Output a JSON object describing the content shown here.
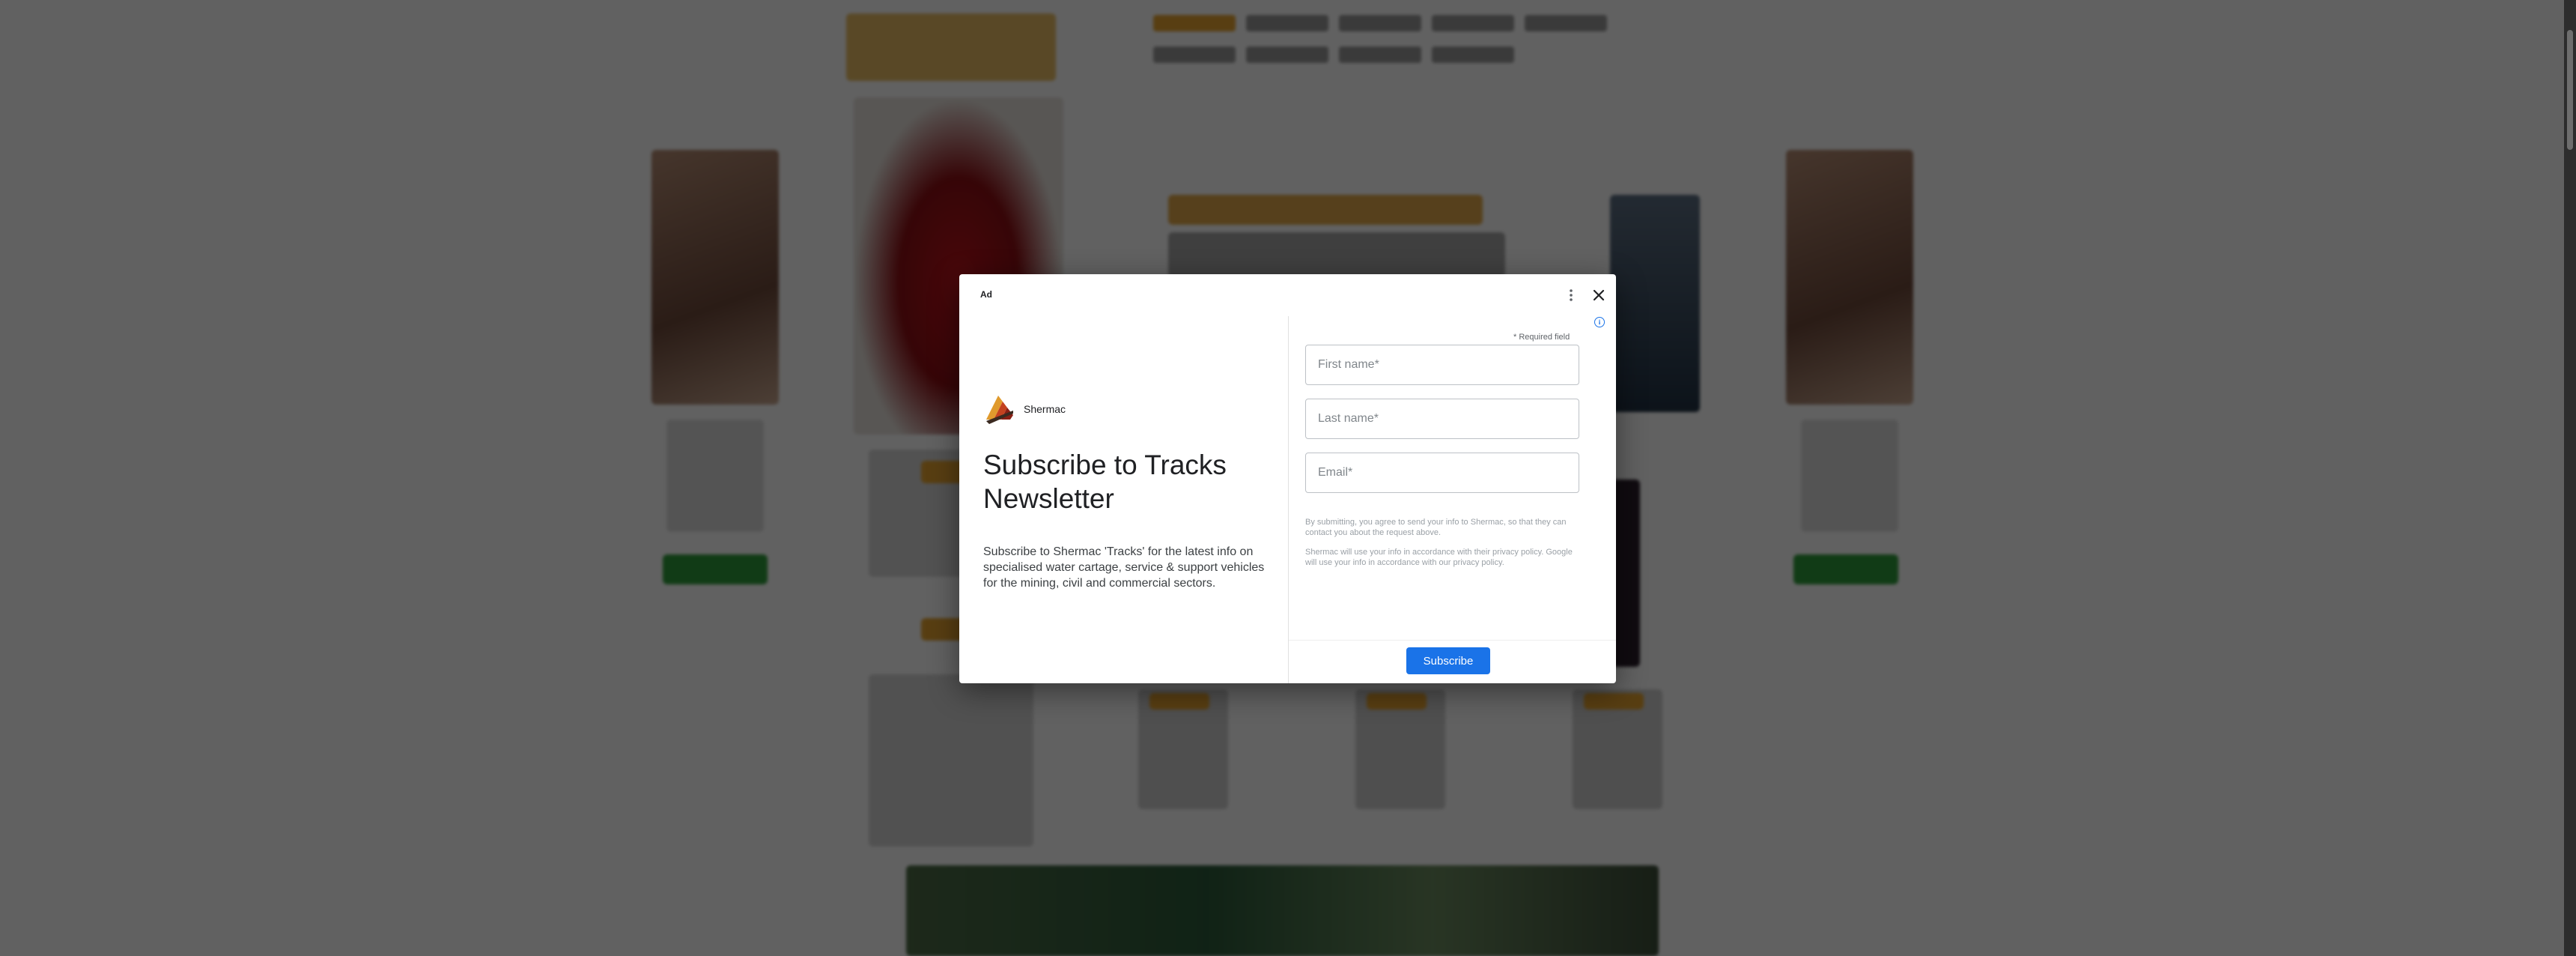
{
  "modal": {
    "ad_label": "Ad",
    "brand": {
      "name": "Shermac"
    },
    "headline": "Subscribe to Tracks Newsletter",
    "description": "Subscribe to Shermac 'Tracks' for the latest info on specialised water cartage, service & support vehicles for the mining, civil and commercial sectors.",
    "form": {
      "required_note": "* Required field",
      "first_name_placeholder": "First name*",
      "last_name_placeholder": "Last name*",
      "email_placeholder": "Email*",
      "consent_1": "By submitting, you agree to send your info to Shermac, so that they can contact you about the request above.",
      "consent_2": "Shermac will use your info in accordance with their privacy policy. Google will use your info in accordance with our privacy policy.",
      "submit_label": "Subscribe"
    },
    "adchoices_glyph": "i"
  },
  "colors": {
    "accent": "#1a73e8",
    "overlay": "rgba(0,0,0,0.62)"
  }
}
